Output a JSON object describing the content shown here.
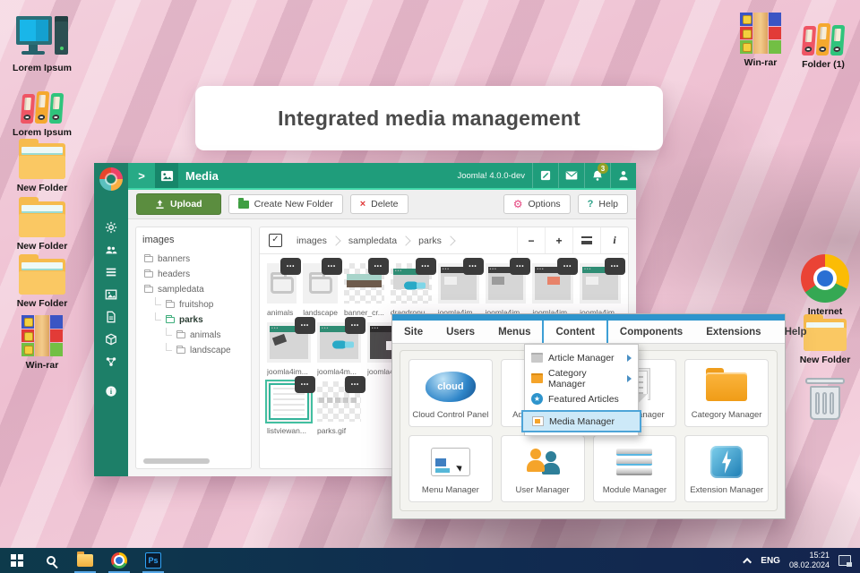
{
  "banner": {
    "title": "Integrated media management"
  },
  "desktop": {
    "left_icons": [
      {
        "label": "Lorem Ipsum",
        "icon": "computer-icon"
      },
      {
        "label": "Lorem Ipsum",
        "icon": "binders-icon"
      },
      {
        "label": "New Folder",
        "icon": "folder-icon"
      },
      {
        "label": "New Folder",
        "icon": "folder-icon"
      },
      {
        "label": "New Folder",
        "icon": "folder-icon"
      },
      {
        "label": "Win-rar",
        "icon": "winrar-icon"
      }
    ],
    "top_right_icons": [
      {
        "label": "Win-rar",
        "icon": "winrar-icon"
      },
      {
        "label": "Folder (1)",
        "icon": "binders-icon"
      }
    ],
    "right_icons": [
      {
        "label": "Internet",
        "icon": "chrome-icon"
      },
      {
        "label": "New Folder",
        "icon": "folder-icon"
      },
      {
        "label": "",
        "icon": "trash-icon"
      }
    ]
  },
  "media_window": {
    "title": "Media",
    "brand": "Joomla! 4.0.0-dev",
    "notification_count": "3",
    "expand_glyph": ">",
    "toolbar": {
      "upload": "Upload",
      "create_folder": "Create New Folder",
      "delete": "Delete",
      "delete_x": "×",
      "options": "Options",
      "options_gear": "⚙",
      "help": "Help",
      "help_q": "?"
    },
    "tree": {
      "root": "images",
      "items": [
        {
          "label": "banners"
        },
        {
          "label": "headers"
        },
        {
          "label": "sampledata"
        },
        {
          "label": "fruitshop"
        },
        {
          "label": "parks"
        },
        {
          "label": "animals"
        },
        {
          "label": "landscape"
        }
      ]
    },
    "breadcrumbs": [
      "images",
      "sampledata",
      "parks"
    ],
    "crumb_check": "✓",
    "view_tools": {
      "zoom_out": "−",
      "zoom_in": "+",
      "info": "i"
    },
    "grid": {
      "row1": [
        {
          "name": "animals"
        },
        {
          "name": "landscape"
        },
        {
          "name": "banner_cr..."
        },
        {
          "name": "dragdropu..."
        },
        {
          "name": "joomla4im..."
        },
        {
          "name": "joomla4im..."
        },
        {
          "name": "joomla4im..."
        },
        {
          "name": "joomla4im..."
        }
      ],
      "row2": [
        {
          "name": "joomla4im..."
        },
        {
          "name": "joomla4m..."
        },
        {
          "name": "joomla4m..."
        },
        {
          "name": "joomla"
        }
      ],
      "row3": [
        {
          "name": "listviewan..."
        },
        {
          "name": "parks.gif"
        }
      ],
      "dots": "•••"
    }
  },
  "admin_window": {
    "menu": [
      {
        "label": "Site"
      },
      {
        "label": "Users"
      },
      {
        "label": "Menus"
      },
      {
        "label": "Content"
      },
      {
        "label": "Components"
      },
      {
        "label": "Extensions"
      },
      {
        "label": "Help"
      }
    ],
    "dropdown": [
      {
        "label": "Article Manager"
      },
      {
        "label": "Category Manager"
      },
      {
        "label": "Featured Articles"
      },
      {
        "label": "Media Manager"
      }
    ],
    "featured_star": "★",
    "cloud_text": "cloud",
    "cards": [
      {
        "label": "Cloud Control Panel"
      },
      {
        "label": "Add New Article"
      },
      {
        "label": "Article Manager"
      },
      {
        "label": "Category Manager"
      },
      {
        "label": "Menu Manager"
      },
      {
        "label": "User Manager"
      },
      {
        "label": "Module Manager"
      },
      {
        "label": "Extension Manager"
      }
    ]
  },
  "taskbar": {
    "lang": "ENG",
    "time": "15:21",
    "date": "08.02.2024",
    "ps_label": "Ps"
  }
}
